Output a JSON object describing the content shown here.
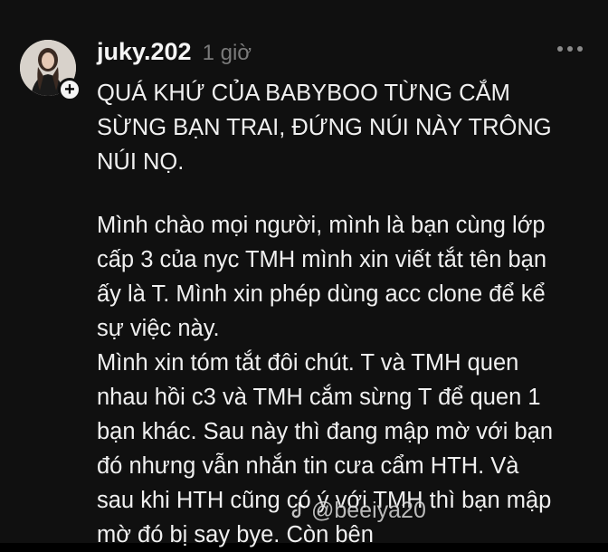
{
  "post": {
    "username": "juky.202",
    "time": "1 giờ",
    "title_lines": [
      "QUÁ KHỨ CỦA BABYBOO TỪNG CẮM",
      "SỪNG BẠN TRAI, ĐỨNG NÚI NÀY TRÔNG",
      "NÚI NỌ."
    ],
    "body_lines": [
      "Mình chào mọi người, mình là bạn cùng lớp",
      "cấp 3 của nyc TMH mình xin viết tắt tên bạn",
      "ấy là T. Mình xin phép dùng acc clone để kể",
      "sự việc này.",
      "Mình xin tóm tắt đôi chút. T và TMH quen",
      "nhau hồi c3 và TMH cắm sừng T để quen 1",
      "bạn khác. Sau này thì đang mập mờ với bạn",
      "đó nhưng vẫn nhắn tin cưa cẩm HTH. Và",
      "sau khi HTH cũng có ý với TMH thì bạn mập",
      "mờ đó bị say bye. Còn bên"
    ]
  },
  "icons": {
    "follow": "plus-icon",
    "more": "more-horizontal-icon",
    "watermark_logo": "tiktok-logo-icon"
  },
  "watermark": {
    "text": "@beeiya20"
  },
  "colors": {
    "background": "#101010",
    "text": "#f0f0f0",
    "muted": "#7a7a7a"
  }
}
